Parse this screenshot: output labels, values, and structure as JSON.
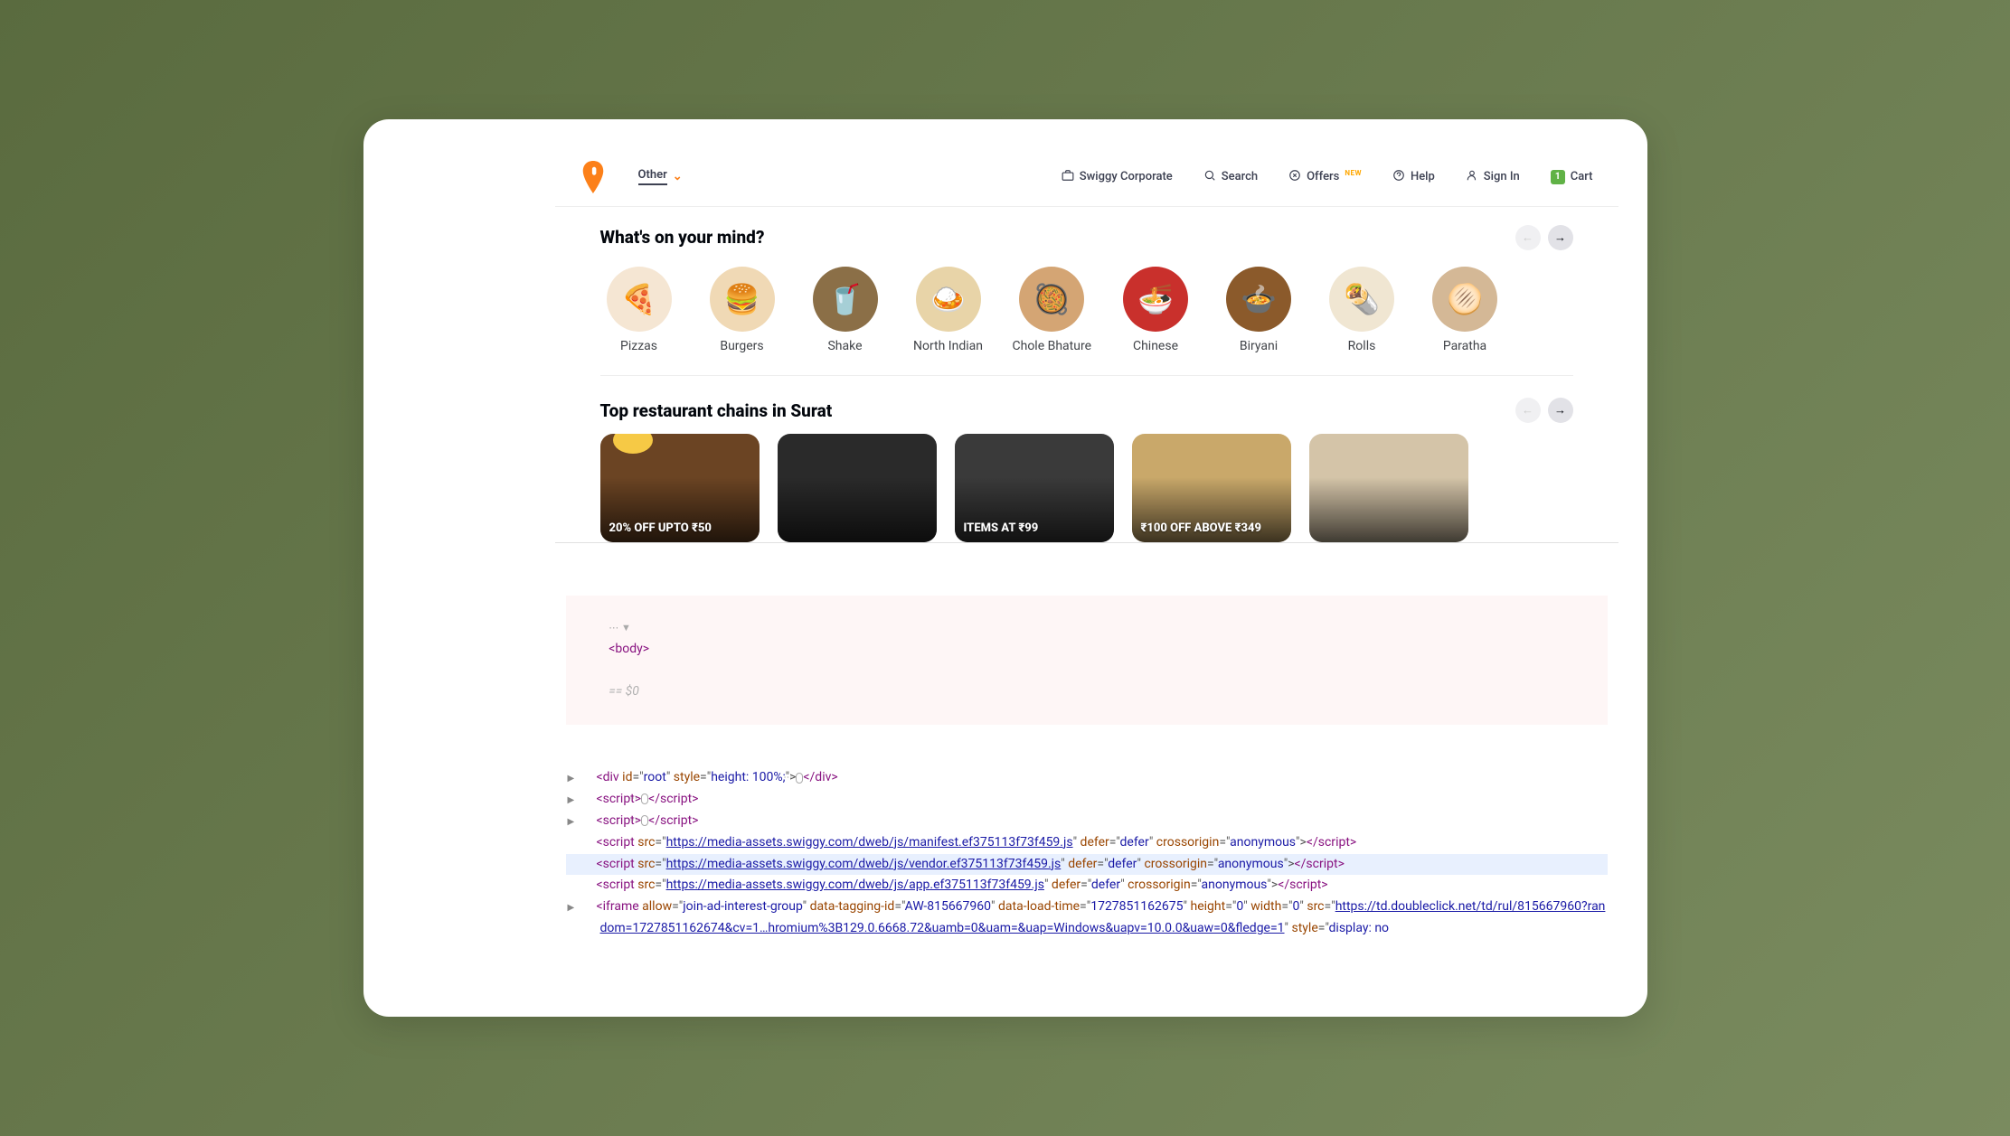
{
  "header": {
    "location": "Other",
    "nav": {
      "corporate": "Swiggy Corporate",
      "search": "Search",
      "offers": "Offers",
      "offers_badge": "NEW",
      "help": "Help",
      "signin": "Sign In",
      "cart": "Cart",
      "cart_count": "1"
    }
  },
  "section1_title": "What's on your mind?",
  "categories": [
    {
      "label": "Pizzas",
      "emoji": "🍕",
      "bg": "#f5e6d3"
    },
    {
      "label": "Burgers",
      "emoji": "🍔",
      "bg": "#f0d9b5"
    },
    {
      "label": "Shake",
      "emoji": "🥤",
      "bg": "#8b6f47"
    },
    {
      "label": "North Indian",
      "emoji": "🍛",
      "bg": "#e8d4a8"
    },
    {
      "label": "Chole Bhature",
      "emoji": "🥘",
      "bg": "#d4a574"
    },
    {
      "label": "Chinese",
      "emoji": "🍜",
      "bg": "#c9302c"
    },
    {
      "label": "Biryani",
      "emoji": "🍲",
      "bg": "#8b5a2b"
    },
    {
      "label": "Rolls",
      "emoji": "🌯",
      "bg": "#f0e6d2"
    },
    {
      "label": "Paratha",
      "emoji": "🫓",
      "bg": "#d4b896"
    }
  ],
  "section2_title": "Top restaurant chains in Surat",
  "restaurants": [
    {
      "offer": "20% OFF UPTO ₹50",
      "bg": "#6b4423"
    },
    {
      "offer": "",
      "bg": "#2a2a2a"
    },
    {
      "offer": "ITEMS AT ₹99",
      "bg": "#3a3a3a"
    },
    {
      "offer": "₹100 OFF ABOVE ₹349",
      "bg": "#c9a86a"
    },
    {
      "offer": "",
      "bg": "#d4c4a8"
    }
  ],
  "devtools": {
    "body_line": "<body>",
    "body_eq": "== $0",
    "lines": [
      {
        "toggle": "▶",
        "indent": 1,
        "parts": [
          {
            "t": "tag",
            "v": "<div "
          },
          {
            "t": "attr",
            "v": "id"
          },
          {
            "t": "plain",
            "v": "=\""
          },
          {
            "t": "val",
            "v": "root"
          },
          {
            "t": "plain",
            "v": "\" "
          },
          {
            "t": "attr",
            "v": "style"
          },
          {
            "t": "plain",
            "v": "=\""
          },
          {
            "t": "val",
            "v": "height: 100%;"
          },
          {
            "t": "plain",
            "v": "\">"
          },
          {
            "t": "dots",
            "v": "⋯"
          },
          {
            "t": "tag",
            "v": "</div>"
          }
        ]
      },
      {
        "toggle": "▶",
        "indent": 1,
        "parts": [
          {
            "t": "tag",
            "v": "<script>"
          },
          {
            "t": "dots",
            "v": "⋯"
          },
          {
            "t": "tag",
            "v": "</scr"
          },
          {
            "t": "tag",
            "v": "ipt>"
          }
        ]
      },
      {
        "toggle": "▶",
        "indent": 1,
        "parts": [
          {
            "t": "tag",
            "v": "<script>"
          },
          {
            "t": "dots",
            "v": "⋯"
          },
          {
            "t": "tag",
            "v": "</scr"
          },
          {
            "t": "tag",
            "v": "ipt>"
          }
        ]
      },
      {
        "toggle": "",
        "indent": 1,
        "parts": [
          {
            "t": "tag",
            "v": "<script "
          },
          {
            "t": "attr",
            "v": "src"
          },
          {
            "t": "plain",
            "v": "=\""
          },
          {
            "t": "url",
            "v": "https://media-assets.swiggy.com/dweb/js/manifest.ef375113f73f459.js"
          },
          {
            "t": "plain",
            "v": "\" "
          },
          {
            "t": "attr",
            "v": "defer"
          },
          {
            "t": "plain",
            "v": "=\""
          },
          {
            "t": "val",
            "v": "defer"
          },
          {
            "t": "plain",
            "v": "\" "
          },
          {
            "t": "attr",
            "v": "crossorigin"
          },
          {
            "t": "plain",
            "v": "=\""
          },
          {
            "t": "val",
            "v": "anonymous"
          },
          {
            "t": "plain",
            "v": "\">"
          },
          {
            "t": "tag",
            "v": "</scr"
          },
          {
            "t": "tag",
            "v": "ipt>"
          }
        ]
      },
      {
        "toggle": "",
        "indent": 1,
        "highlight": true,
        "parts": [
          {
            "t": "tag",
            "v": "<script "
          },
          {
            "t": "attr",
            "v": "src"
          },
          {
            "t": "plain",
            "v": "=\""
          },
          {
            "t": "url",
            "v": "https://media-assets.swiggy.com/dweb/js/vendor.ef375113f73f459.js"
          },
          {
            "t": "plain",
            "v": "\" "
          },
          {
            "t": "attr",
            "v": "defer"
          },
          {
            "t": "plain",
            "v": "=\""
          },
          {
            "t": "val",
            "v": "defer"
          },
          {
            "t": "plain",
            "v": "\" "
          },
          {
            "t": "attr",
            "v": "crossorigin"
          },
          {
            "t": "plain",
            "v": "=\""
          },
          {
            "t": "val",
            "v": "anonymous"
          },
          {
            "t": "plain",
            "v": "\">"
          },
          {
            "t": "tag",
            "v": "</scr"
          },
          {
            "t": "tag",
            "v": "ipt>"
          }
        ]
      },
      {
        "toggle": "",
        "indent": 1,
        "parts": [
          {
            "t": "tag",
            "v": "<script "
          },
          {
            "t": "attr",
            "v": "src"
          },
          {
            "t": "plain",
            "v": "=\""
          },
          {
            "t": "url",
            "v": "https://media-assets.swiggy.com/dweb/js/app.ef375113f73f459.js"
          },
          {
            "t": "plain",
            "v": "\" "
          },
          {
            "t": "attr",
            "v": "defer"
          },
          {
            "t": "plain",
            "v": "=\""
          },
          {
            "t": "val",
            "v": "defer"
          },
          {
            "t": "plain",
            "v": "\" "
          },
          {
            "t": "attr",
            "v": "crossorigin"
          },
          {
            "t": "plain",
            "v": "=\""
          },
          {
            "t": "val",
            "v": "anonymous"
          },
          {
            "t": "plain",
            "v": "\">"
          },
          {
            "t": "tag",
            "v": "</scr"
          },
          {
            "t": "tag",
            "v": "ipt>"
          }
        ]
      },
      {
        "toggle": "▶",
        "indent": 1,
        "parts": [
          {
            "t": "tag",
            "v": "<iframe "
          },
          {
            "t": "attr",
            "v": "allow"
          },
          {
            "t": "plain",
            "v": "=\""
          },
          {
            "t": "val",
            "v": "join-ad-interest-group"
          },
          {
            "t": "plain",
            "v": "\" "
          },
          {
            "t": "attr",
            "v": "data-tagging-id"
          },
          {
            "t": "plain",
            "v": "=\""
          },
          {
            "t": "val",
            "v": "AW-815667960"
          },
          {
            "t": "plain",
            "v": "\" "
          },
          {
            "t": "attr",
            "v": "data-load-time"
          },
          {
            "t": "plain",
            "v": "=\""
          },
          {
            "t": "val",
            "v": "17278511626"
          },
          {
            "t": "val",
            "v": "75"
          },
          {
            "t": "plain",
            "v": "\" "
          },
          {
            "t": "attr",
            "v": "height"
          },
          {
            "t": "plain",
            "v": "=\""
          },
          {
            "t": "val",
            "v": "0"
          },
          {
            "t": "plain",
            "v": "\" "
          },
          {
            "t": "attr",
            "v": "width"
          },
          {
            "t": "plain",
            "v": "=\""
          },
          {
            "t": "val",
            "v": "0"
          },
          {
            "t": "plain",
            "v": "\" "
          },
          {
            "t": "attr",
            "v": "src"
          },
          {
            "t": "plain",
            "v": "=\""
          },
          {
            "t": "url",
            "v": "https://td.doubleclick.net/td/rul/815667960?random=1727851162674&cv=1…hromium%3B129.0.6668.72&uamb=0&uam=&uap=Windows&uapv=10.0.0&uaw=0&fledge=1"
          },
          {
            "t": "plain",
            "v": "\" "
          },
          {
            "t": "attr",
            "v": "style"
          },
          {
            "t": "plain",
            "v": "=\""
          },
          {
            "t": "val",
            "v": "display: no"
          }
        ]
      }
    ]
  }
}
